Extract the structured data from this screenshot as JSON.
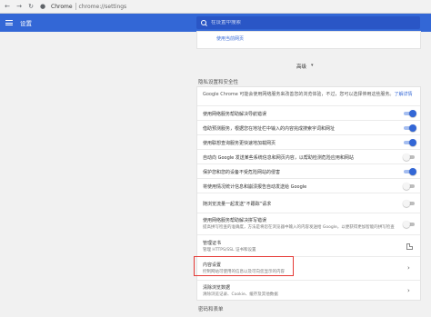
{
  "browser": {
    "app_name": "Chrome",
    "url": "chrome://settings"
  },
  "header": {
    "title": "设置",
    "search_placeholder": "在设置中搜索"
  },
  "top_card": {
    "link": "使用当前网页"
  },
  "advanced": {
    "label": "高级",
    "arrow": "▾"
  },
  "privacy": {
    "section_title": "隐私设置和安全性",
    "intro_text": "Google Chrome 可能会使用网络服务来改善您的浏览体验，不过，您可以选择停用这些服务。",
    "intro_link": "了解详情",
    "rows": [
      {
        "label": "使用网络服务帮助解决导航错误",
        "toggle": "on"
      },
      {
        "label": "借助预测服务，根据您在地址栏中输入的内容完成搜索字词和网址",
        "toggle": "on"
      },
      {
        "label": "使用联想查询服务更快速地加载网页",
        "toggle": "on"
      },
      {
        "label": "自动向 Google 发送某些系统信息和网页内容，以帮助检测危险应用和网站",
        "toggle": "off"
      },
      {
        "label": "保护您和您的设备不受危险网站的侵害",
        "toggle": "on"
      },
      {
        "label": "将使用情况统计信息和崩溃报告自动发送给 Google",
        "toggle": "off"
      },
      {
        "label": "随浏览流量一起发送“不跟踪”请求",
        "toggle": "off"
      }
    ],
    "spelling": {
      "label": "使用网络服务帮助解决拼写错误",
      "sub": "提高拼写检查的准确度，方法是将您在浏览器中输入的内容发送给 Google，以便获得更加智能的拼写检查",
      "toggle": "off"
    },
    "certs": {
      "label": "管理证书",
      "sub": "管理 HTTPS/SSL 证书和设置"
    },
    "content": {
      "label": "内容设置",
      "sub": "控制网站可使用的信息以及可向您显示的内容"
    },
    "clear": {
      "label": "清除浏览数据",
      "sub": "清除浏览记录、Cookie、缓存及其他数据"
    }
  },
  "bottom_section_title": "密码和表单"
}
